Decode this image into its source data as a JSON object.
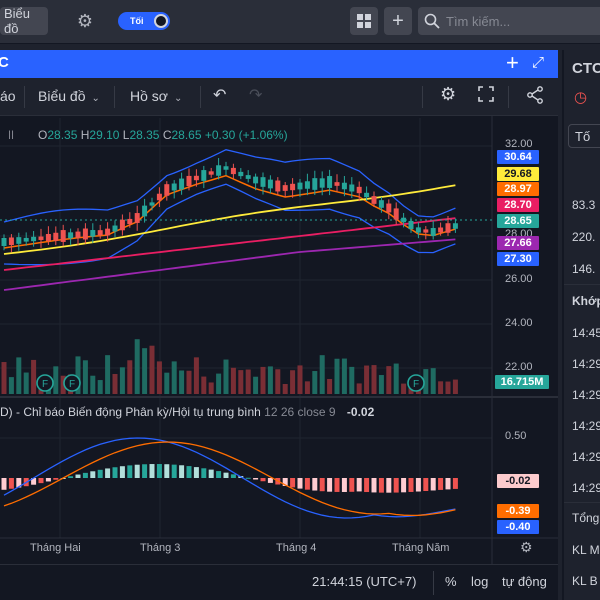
{
  "topbar": {
    "chart_button": "Biểu đồ",
    "theme_label": "Tối",
    "search_placeholder": "Tìm kiếm..."
  },
  "panel": {
    "title": "C",
    "toolbar": {
      "interval": "áo",
      "chart_menu": "Biểu đồ",
      "profile_menu": "Hồ sơ"
    }
  },
  "ohlc": {
    "o_label": "O",
    "o": "28.35",
    "h_label": "H",
    "h": "29.10",
    "l_label": "L",
    "l": "28.35",
    "c_label": "C",
    "c": "28.65",
    "change": "+0.30 (+1.06%)"
  },
  "price_axis": [
    "32.00",
    "28.00",
    "26.00",
    "24.00",
    "22.00"
  ],
  "price_tags": [
    {
      "text": "30.64",
      "bg": "#2962ff",
      "fg": "#ffffff"
    },
    {
      "text": "29.68",
      "bg": "#ffeb3b",
      "fg": "#131722"
    },
    {
      "text": "28.97",
      "bg": "#ff6d00",
      "fg": "#ffffff"
    },
    {
      "text": "28.70",
      "bg": "#e91e63",
      "fg": "#ffffff"
    },
    {
      "text": "28.65",
      "bg": "#26a69a",
      "fg": "#ffffff"
    },
    {
      "text": "27.66",
      "bg": "#9c27b0",
      "fg": "#ffffff"
    },
    {
      "text": "27.30",
      "bg": "#2962ff",
      "fg": "#ffffff"
    }
  ],
  "volume_tag": "16.715M",
  "macd": {
    "title": "D) - Chỉ báo Biến động Phân kỳ/Hội tụ trung bình",
    "params": "12 26 close 9",
    "value": "-0.02",
    "axis": "0.50",
    "tags": [
      {
        "text": "-0.02",
        "bg": "#fccbcd",
        "fg": "#131722"
      },
      {
        "text": "-0.39",
        "bg": "#ff6d00",
        "fg": "#ffffff"
      },
      {
        "text": "-0.40",
        "bg": "#2962ff",
        "fg": "#ffffff"
      }
    ]
  },
  "time_axis": [
    "Tháng Hai",
    "Tháng 3",
    "Tháng 4",
    "Tháng Năm"
  ],
  "footer": {
    "clock": "21:44:15 (UTC+7)",
    "percent": "%",
    "log": "log",
    "auto": "tự động"
  },
  "events_label": "F",
  "right_panel": {
    "symbol": "CTC",
    "button": "Tố",
    "prices": [
      "83.3",
      "220.",
      "146."
    ],
    "section": "Khớp",
    "times": [
      "14:45",
      "14:29",
      "14:29",
      "14:29",
      "14:29",
      "14:29"
    ],
    "summary": [
      "Tổng",
      "KL M",
      "KL B"
    ]
  },
  "colors": {
    "up": "#26a69a",
    "down": "#ef5350",
    "accent": "#2962ff"
  }
}
